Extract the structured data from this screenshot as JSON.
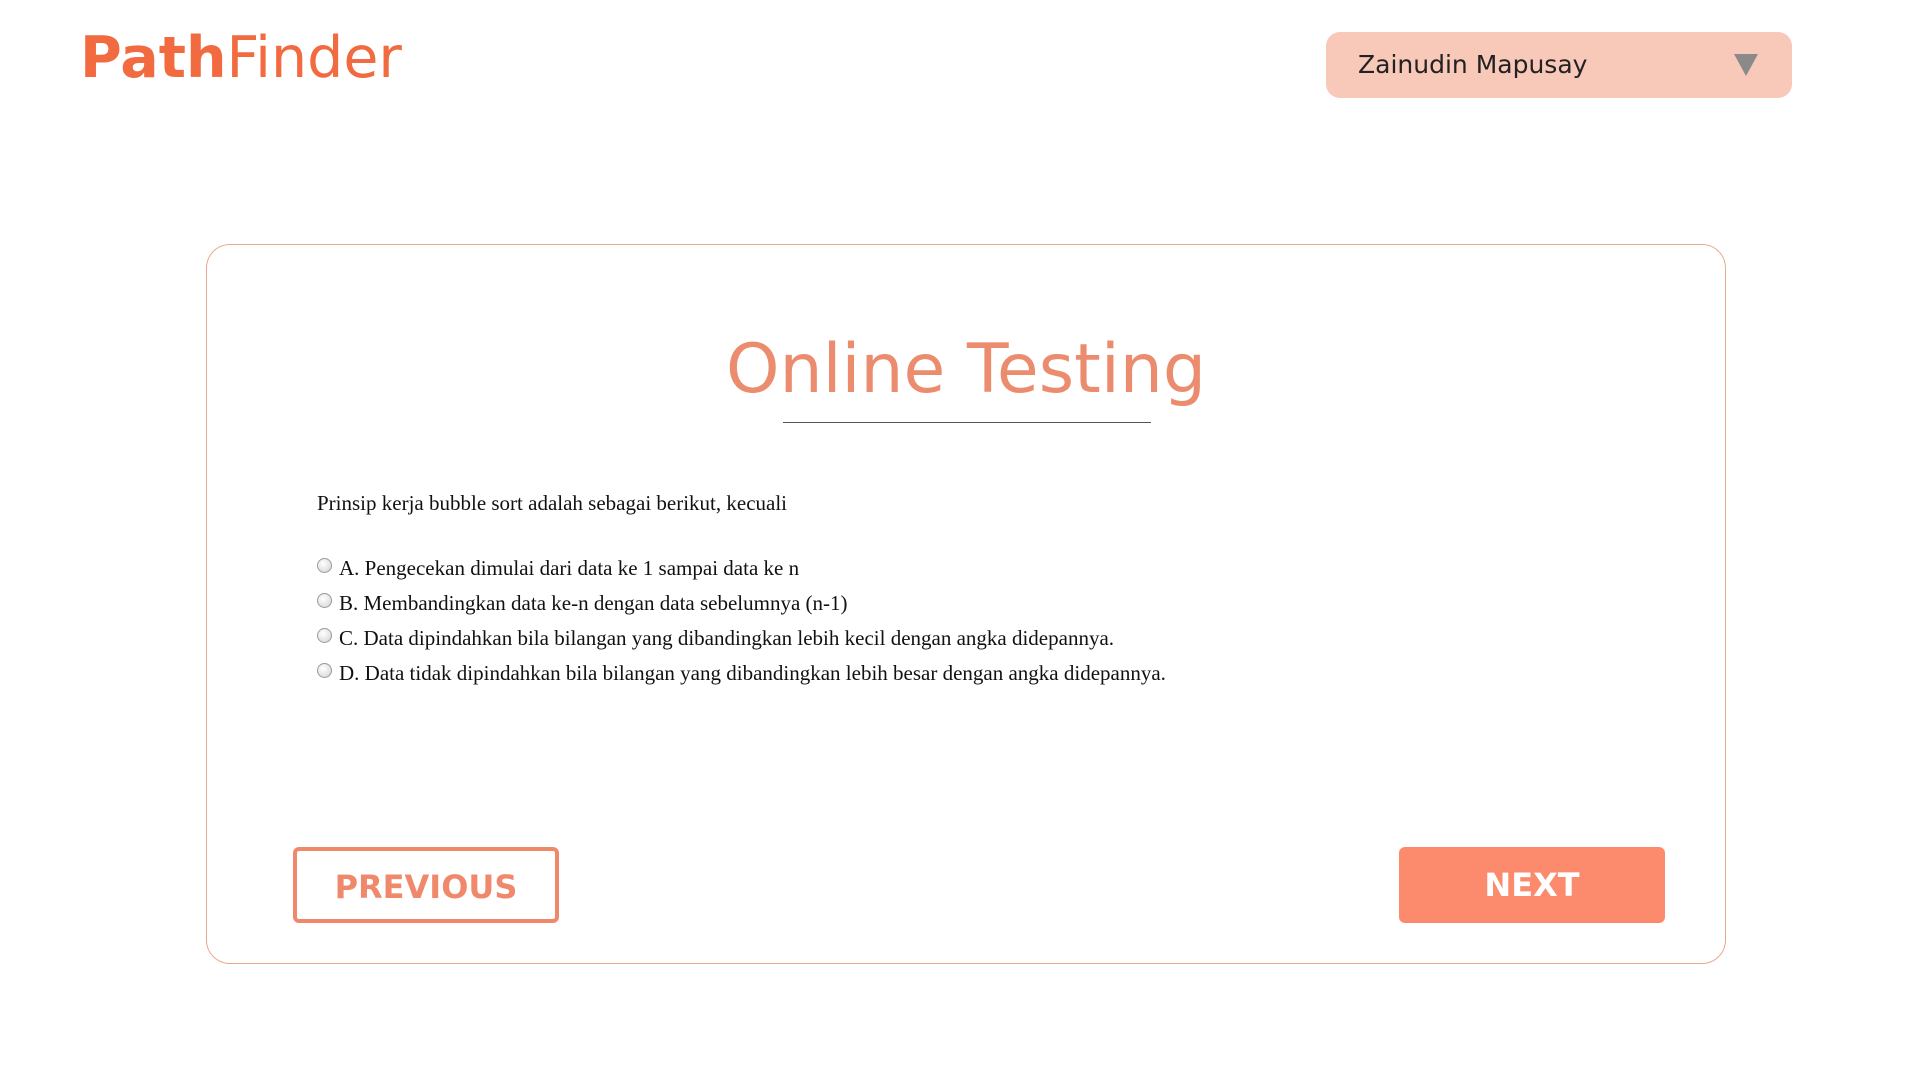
{
  "header": {
    "logo_bold": "Path",
    "logo_light": "Finder",
    "user_name": "Zainudin Mapusay"
  },
  "test": {
    "title": "Online Testing",
    "question": "Prinsip kerja bubble sort adalah sebagai berikut, kecuali",
    "options": [
      {
        "label": "A. Pengecekan dimulai dari data ke 1 sampai data ke n",
        "selected": false
      },
      {
        "label": "B. Membandingkan data ke-n dengan data sebelumnya (n-1)",
        "selected": false
      },
      {
        "label": "C. Data dipindahkan bila bilangan yang dibandingkan lebih kecil dengan angka didepannya.",
        "selected": false
      },
      {
        "label": "D. Data tidak dipindahkan bila bilangan yang dibandingkan lebih besar dengan angka didepannya.",
        "selected": false
      }
    ],
    "previous_label": "PREVIOUS",
    "next_label": "NEXT"
  },
  "colors": {
    "brand": "#f26a3f",
    "accent": "#fb8b6c",
    "title": "#ec8c6f",
    "user_menu_bg": "#f8c8b8"
  },
  "icons": {
    "user_menu_caret": "caret-down-icon"
  }
}
